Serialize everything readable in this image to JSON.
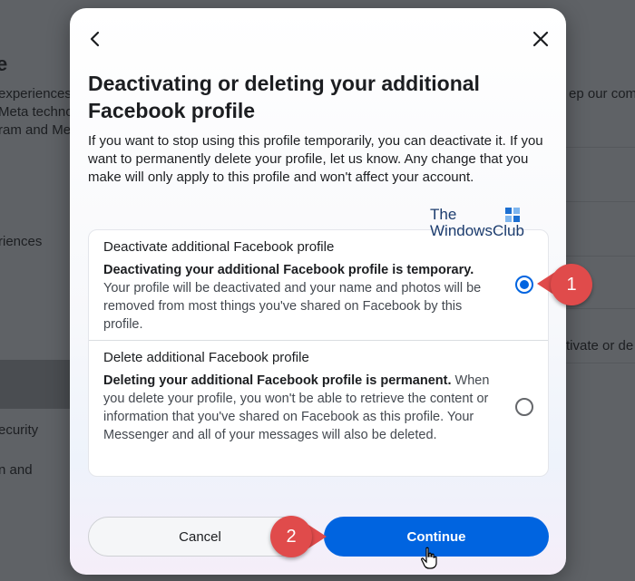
{
  "background": {
    "title_fragment": "e",
    "lines": [
      "experiences",
      "Meta techno",
      "ram and Me"
    ],
    "nav_fragment_1": "riences",
    "nav_fragment_2": "ecurity",
    "nav_fragment_3": "n and",
    "right_fragment_1": "ep our com",
    "right_fragment_2": "tivate or de"
  },
  "modal": {
    "back_icon": "chevron-left-icon",
    "close_icon": "close-icon",
    "title": "Deactivating or deleting your additional Facebook profile",
    "description": "If you want to stop using this profile temporarily, you can deactivate it. If you want to permanently delete your profile, let us know. Any change that you make will only apply to this profile and won't affect your account.",
    "watermark_line1": "The",
    "watermark_line2": "WindowsClub",
    "options": [
      {
        "label": "Deactivate additional Facebook profile",
        "bold_text": "Deactivating your additional Facebook profile is temporary.",
        "text": " Your profile will be deactivated and your name and photos will be removed from most things you've shared on Facebook by this profile.",
        "selected": true
      },
      {
        "label": "Delete additional Facebook profile",
        "bold_text": "Deleting your additional Facebook profile is permanent.",
        "text": " When you delete your profile, you won't be able to retrieve the content or information that you've shared on Facebook as this profile. Your Messenger and all of your messages will also be deleted.",
        "selected": false
      }
    ],
    "cancel_label": "Cancel",
    "continue_label": "Continue"
  },
  "annotations": {
    "marker_1": "1",
    "marker_2": "2"
  },
  "colors": {
    "accent": "#0064e0",
    "marker": "#e04b4b"
  }
}
